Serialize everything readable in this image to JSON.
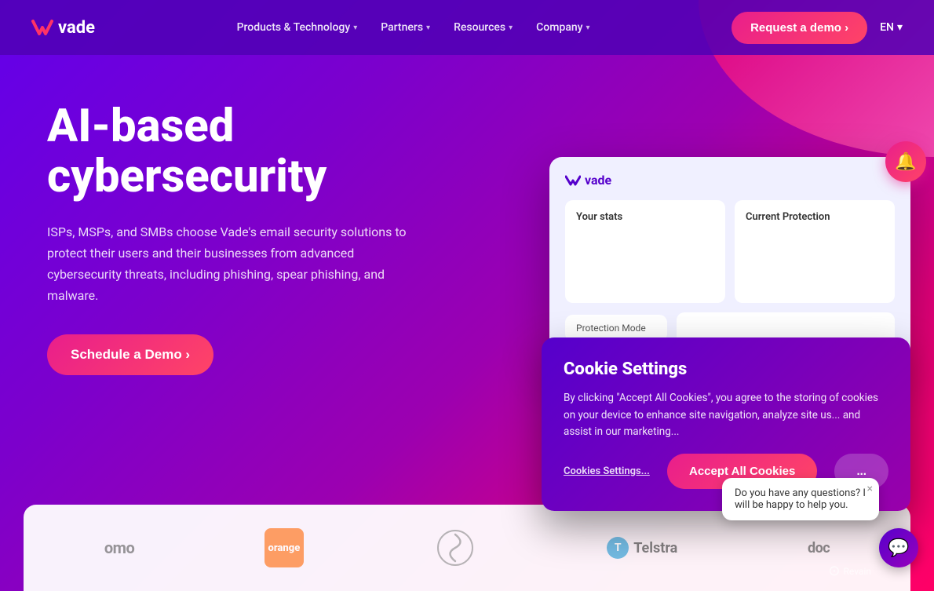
{
  "nav": {
    "logo_text": "vade",
    "links": [
      {
        "label": "Products & Technology",
        "has_dropdown": true
      },
      {
        "label": "Partners",
        "has_dropdown": true
      },
      {
        "label": "Resources",
        "has_dropdown": true
      },
      {
        "label": "Company",
        "has_dropdown": true
      }
    ],
    "cta_label": "Request a demo ›",
    "lang": "EN"
  },
  "hero": {
    "title": "AI-based cybersecurity",
    "subtitle": "ISPs, MSPs, and SMBs choose Vade's email security solutions to protect their users and their businesses from advanced cybersecurity threats, including phishing, spear phishing, and malware.",
    "cta_label": "Schedule a Demo ›"
  },
  "dashboard": {
    "logo": "vade",
    "panel_stats_title": "Your stats",
    "panel_protection_title": "Current Protection",
    "protection_mode_label": "Protection Mode"
  },
  "cookie_modal": {
    "title": "Cookie Settings",
    "body": "By clicking \"Accept All Cookies\", you agree to the storing of cookies on your device to enhance site navigation, analyze site us... and assist in our marketing...",
    "settings_link": "Cookies Settings...",
    "accept_label": "Accept All Cookies",
    "decline_label": "..."
  },
  "chat": {
    "bubble_text": "Do you have any questions? I will be happy to help you.",
    "close_label": "×"
  },
  "logos": [
    {
      "id": "omo",
      "text": "omo"
    },
    {
      "id": "orange",
      "text": "orange"
    },
    {
      "id": "swirl",
      "text": ""
    },
    {
      "id": "telstra",
      "text": "Telstra"
    },
    {
      "id": "doc",
      "text": "doc"
    }
  ],
  "bell": {
    "icon": "🔔"
  },
  "revain": {
    "text": "Revain"
  }
}
